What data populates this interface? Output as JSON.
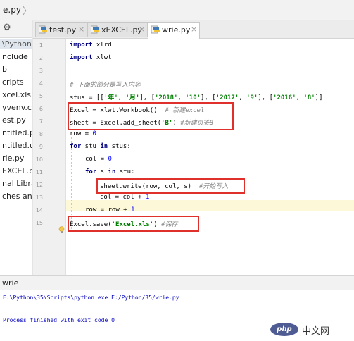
{
  "breadcrumb": {
    "file": "e.py"
  },
  "project_panel": {
    "items": [
      "\\Python\\",
      "nclude",
      "b",
      "cripts",
      "xcel.xls",
      "yvenv.cfg",
      "est.py",
      "ntitled.py",
      "ntitled.ui",
      "rie.py",
      "EXCEL.py",
      "nal Libra",
      "ches and"
    ]
  },
  "tabs": [
    {
      "label": "test.py",
      "close": "×"
    },
    {
      "label": "xEXCEL.py",
      "close": "×"
    },
    {
      "label": "wrie.py",
      "close": "×"
    }
  ],
  "editor": {
    "line_numbers": [
      "1",
      "2",
      "3",
      "4",
      "5",
      "6",
      "7",
      "8",
      "9",
      "10",
      "11",
      "12",
      "13",
      "14",
      "15"
    ],
    "lines": {
      "l1_kw": "import",
      "l1_rest": " xlrd",
      "l2_kw": "import",
      "l2_rest": " xlwt",
      "l4": "# 下面的部分是写入内容",
      "l5_a": "stus = [[",
      "l5_s1": "'年'",
      "l5_b": ", ",
      "l5_s2": "'月'",
      "l5_c": "], [",
      "l5_s3": "'2018'",
      "l5_d": ", ",
      "l5_s4": "'10'",
      "l5_e": "], [",
      "l5_s5": "'2017'",
      "l5_f": ", ",
      "l5_s6": "'9'",
      "l5_g": "], [",
      "l5_s7": "'2016'",
      "l5_h": ", ",
      "l5_s8": "'8'",
      "l5_i": "]]",
      "l6_code": "Excel = xlwt.Workbook()",
      "l6_cm": "  # 新建excel",
      "l7_a": "sheet = Excel.add_sheet(",
      "l7_s": "'B'",
      "l7_b": ")",
      "l7_cm": " #新建页签B",
      "l8_a": "row = ",
      "l8_n": "0",
      "l9_kw1": "for",
      "l9_a": " stu ",
      "l9_kw2": "in",
      "l9_b": " stus:",
      "l10_a": "col = ",
      "l10_n": "0",
      "l11_kw1": "for",
      "l11_a": " s ",
      "l11_kw2": "in",
      "l11_b": " stu:",
      "l12_code": "sheet.write(row, col, s)",
      "l12_cm": "  #开始写入",
      "l13_a": "col = col + ",
      "l13_n": "1",
      "l14_a": "row = row + ",
      "l14_n": "1",
      "l15_a": "Excel.save(",
      "l15_s": "'Excel.xls'",
      "l15_b": ")",
      "l15_cm": " #保存"
    }
  },
  "run_panel": {
    "title": "wrie",
    "command": "E:\\Python\\35\\Scripts\\python.exe E:/Python/35/wrie.py",
    "exit_message": "Process finished with exit code 0"
  },
  "watermark": {
    "logo": "php",
    "text": "中文网"
  },
  "colors": {
    "highlight_border": "#e0302c",
    "keyword": "#000080",
    "string": "#008000",
    "comment": "#808080",
    "number": "#0000ff",
    "console_text": "#0000c0"
  }
}
